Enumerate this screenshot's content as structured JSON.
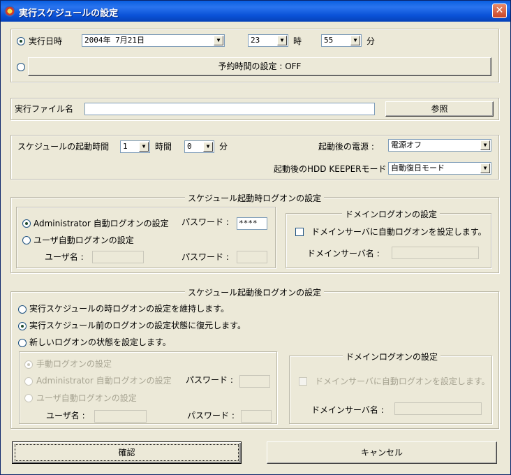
{
  "window": {
    "title": "実行スケジュールの設定",
    "close_glyph": "✕"
  },
  "exec": {
    "datetime_label": "実行日時",
    "date_value": "2004年 7月21日",
    "hour_value": "23",
    "hour_unit": "時",
    "minute_value": "55",
    "minute_unit": "分",
    "reserve_button": "予約時間の設定 : OFF"
  },
  "file": {
    "label": "実行ファイル名",
    "value": "",
    "browse_button": "参照"
  },
  "schedule": {
    "start_label": "スケジュールの起動時間",
    "hours_value": "1",
    "hours_unit": "時間",
    "minutes_value": "0",
    "minutes_unit": "分",
    "power_label": "起動後の電源 :",
    "power_value": "電源オフ",
    "hdd_label": "起動後のHDD KEEPERモード :",
    "hdd_value": "自動復日モード"
  },
  "logon_start": {
    "title": "スケジュール起動時ログオンの設定",
    "admin_auto": "Administrator 自動ログオンの設定",
    "password_label": "パスワード :",
    "password_value": "****",
    "user_auto": "ユーザ自動ログオンの設定",
    "username_label": "ユーザ名 :",
    "password2_label": "パスワード :",
    "domain": {
      "title": "ドメインログオンの設定",
      "checkbox_label": "ドメインサーバに自動ログオンを設定します。",
      "server_label": "ドメインサーバ名 :"
    }
  },
  "logon_after": {
    "title": "スケジュール起動後ログオンの設定",
    "opt_keep": "実行スケジュールの時ログオンの設定を維持します。",
    "opt_restore": "実行スケジュール前のログオンの設定状態に復元します。",
    "opt_new": "新しいログオンの状態を設定します。",
    "manual": "手動ログオンの設定",
    "admin_auto": "Administrator 自動ログオンの設定",
    "password_label": "パスワード :",
    "user_auto": "ユーザ自動ログオンの設定",
    "username_label": "ユーザ名 :",
    "password2_label": "パスワード :",
    "domain": {
      "title": "ドメインログオンの設定",
      "checkbox_label": "ドメインサーバに自動ログオンを設定します。",
      "server_label": "ドメインサーバ名 :"
    }
  },
  "buttons": {
    "ok": "確認",
    "cancel": "キャンセル"
  },
  "colors": {
    "titlebar": "#0a5fe0",
    "dialog_bg": "#ece9d8",
    "disabled_text": "#a7a492"
  }
}
